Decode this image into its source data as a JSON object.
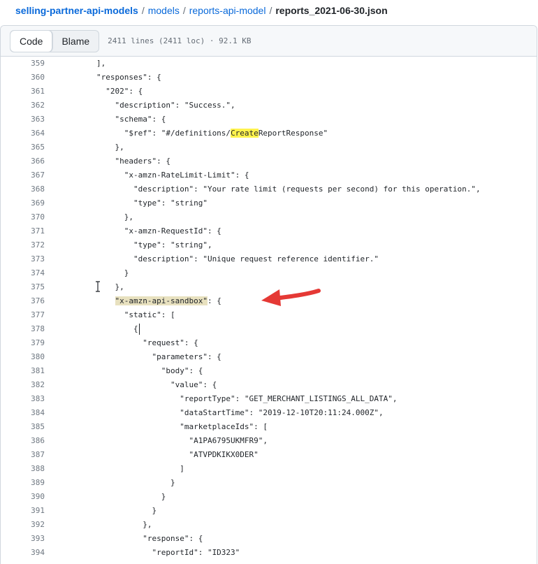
{
  "breadcrumb": {
    "repo": "selling-partner-api-models",
    "models": "models",
    "folder": "reports-api-model",
    "file": "reports_2021-06-30.json",
    "separator": "/"
  },
  "toolbar": {
    "code_label": "Code",
    "blame_label": "Blame",
    "file_info": "2411 lines (2411 loc) · 92.1 KB"
  },
  "colors": {
    "link": "#0969da",
    "search_highlight": "#fff34d",
    "selection_highlight": "#e8e1bf",
    "arrow": "#e53935"
  },
  "code_lines": [
    {
      "n": "359",
      "t": "],"
    },
    {
      "n": "360",
      "t": "\"responses\": {"
    },
    {
      "n": "361",
      "t": "  \"202\": {"
    },
    {
      "n": "362",
      "t": "    \"description\": \"Success.\","
    },
    {
      "n": "363",
      "t": "    \"schema\": {"
    },
    {
      "n": "364",
      "t": "      \"$ref\": \"#/definitions/CreateReportResponse\""
    },
    {
      "n": "365",
      "t": "    },"
    },
    {
      "n": "366",
      "t": "    \"headers\": {"
    },
    {
      "n": "367",
      "t": "      \"x-amzn-RateLimit-Limit\": {"
    },
    {
      "n": "368",
      "t": "        \"description\": \"Your rate limit (requests per second) for this operation.\","
    },
    {
      "n": "369",
      "t": "        \"type\": \"string\""
    },
    {
      "n": "370",
      "t": "      },"
    },
    {
      "n": "371",
      "t": "      \"x-amzn-RequestId\": {"
    },
    {
      "n": "372",
      "t": "        \"type\": \"string\","
    },
    {
      "n": "373",
      "t": "        \"description\": \"Unique request reference identifier.\""
    },
    {
      "n": "374",
      "t": "      }"
    },
    {
      "n": "375",
      "t": "    },"
    },
    {
      "n": "376",
      "t": "    \"x-amzn-api-sandbox\": {"
    },
    {
      "n": "377",
      "t": "      \"static\": ["
    },
    {
      "n": "378",
      "t": "        {"
    },
    {
      "n": "379",
      "t": "          \"request\": {"
    },
    {
      "n": "380",
      "t": "            \"parameters\": {"
    },
    {
      "n": "381",
      "t": "              \"body\": {"
    },
    {
      "n": "382",
      "t": "                \"value\": {"
    },
    {
      "n": "383",
      "t": "                  \"reportType\": \"GET_MERCHANT_LISTINGS_ALL_DATA\","
    },
    {
      "n": "384",
      "t": "                  \"dataStartTime\": \"2019-12-10T20:11:24.000Z\","
    },
    {
      "n": "385",
      "t": "                  \"marketplaceIds\": ["
    },
    {
      "n": "386",
      "t": "                    \"A1PA6795UKMFR9\","
    },
    {
      "n": "387",
      "t": "                    \"ATVPDKIKX0DER\""
    },
    {
      "n": "388",
      "t": "                  ]"
    },
    {
      "n": "389",
      "t": "                }"
    },
    {
      "n": "390",
      "t": "              }"
    },
    {
      "n": "391",
      "t": "            }"
    },
    {
      "n": "392",
      "t": "          },"
    },
    {
      "n": "393",
      "t": "          \"response\": {"
    },
    {
      "n": "394",
      "t": "            \"reportId\": \"ID323\""
    }
  ]
}
